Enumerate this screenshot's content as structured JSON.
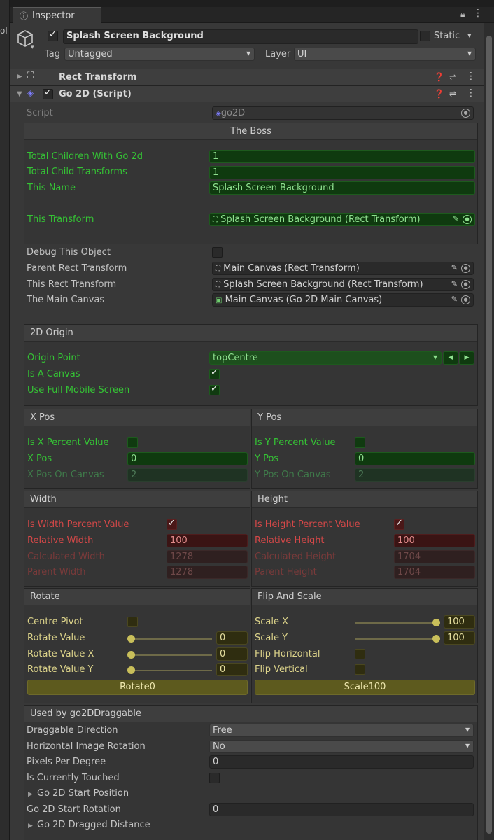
{
  "window": {
    "tab_title": "Inspector",
    "left_partial_text": "ol"
  },
  "object": {
    "name": "Splash Screen Background",
    "static_label": "Static",
    "tag_label": "Tag",
    "tag_value": "Untagged",
    "layer_label": "Layer",
    "layer_value": "UI"
  },
  "components": {
    "rect_transform": "Rect Transform",
    "go2d": "Go 2D (Script)"
  },
  "script": {
    "label": "Script",
    "value": "go2D"
  },
  "boss": {
    "title": "The Boss",
    "rows": [
      {
        "label": "Total Children With Go 2d",
        "value": "1"
      },
      {
        "label": "Total Child Transforms",
        "value": "1"
      },
      {
        "label": "This Name",
        "value": "Splash Screen Background"
      }
    ],
    "transform_label": "This Transform",
    "transform_value": "Splash Screen Background (Rect Transform)"
  },
  "refs": {
    "debug_label": "Debug This Object",
    "parent_label": "Parent Rect Transform",
    "parent_value": "Main Canvas (Rect Transform)",
    "this_label": "This Rect Transform",
    "this_value": "Splash Screen Background (Rect Transform)",
    "canvas_label": "The Main Canvas",
    "canvas_value": "Main Canvas (Go 2D Main Canvas)"
  },
  "origin": {
    "title": "2D Origin",
    "point_label": "Origin Point",
    "point_value": "topCentre",
    "canvas_label": "Is A Canvas",
    "mobile_label": "Use Full Mobile Screen"
  },
  "xpos": {
    "title": "X Pos",
    "percent_label": "Is X Percent Value",
    "pos_label": "X Pos",
    "pos_value": "0",
    "canvas_label": "X Pos On Canvas",
    "canvas_value": "2"
  },
  "ypos": {
    "title": "Y Pos",
    "percent_label": "Is Y Percent Value",
    "pos_label": "Y Pos",
    "pos_value": "0",
    "canvas_label": "Y Pos On Canvas",
    "canvas_value": "2"
  },
  "width": {
    "title": "Width",
    "percent_label": "Is Width Percent Value",
    "rel_label": "Relative Width",
    "rel_value": "100",
    "calc_label": "Calculated Width",
    "calc_value": "1278",
    "parent_label": "Parent Width",
    "parent_value": "1278"
  },
  "height": {
    "title": "Height",
    "percent_label": "Is Height Percent Value",
    "rel_label": "Relative Height",
    "rel_value": "100",
    "calc_label": "Calculated Height",
    "calc_value": "1704",
    "parent_label": "Parent Height",
    "parent_value": "1704"
  },
  "rotate": {
    "title": "Rotate",
    "pivot_label": "Centre Pivot",
    "value_label": "Rotate Value",
    "value": "0",
    "x_label": "Rotate Value X",
    "x_value": "0",
    "y_label": "Rotate Value Y",
    "y_value": "0",
    "button": "Rotate0"
  },
  "flip": {
    "title": "Flip And Scale",
    "sx_label": "Scale X",
    "sx_value": "100",
    "sy_label": "Scale Y",
    "sy_value": "100",
    "fh_label": "Flip Horizontal",
    "fv_label": "Flip Vertical",
    "button": "Scale100"
  },
  "draggable": {
    "title": "Used by go2DDraggable",
    "dir_label": "Draggable Direction",
    "dir_value": "Free",
    "rot_label": "Horizontal Image Rotation",
    "rot_value": "No",
    "ppd_label": "Pixels Per Degree",
    "ppd_value": "0",
    "touched_label": "Is Currently Touched",
    "startpos_label": "Go 2D Start Position",
    "startrot_label": "Go 2D Start Rotation",
    "startrot_value": "0",
    "dist_label": "Go 2D Dragged Distance"
  }
}
